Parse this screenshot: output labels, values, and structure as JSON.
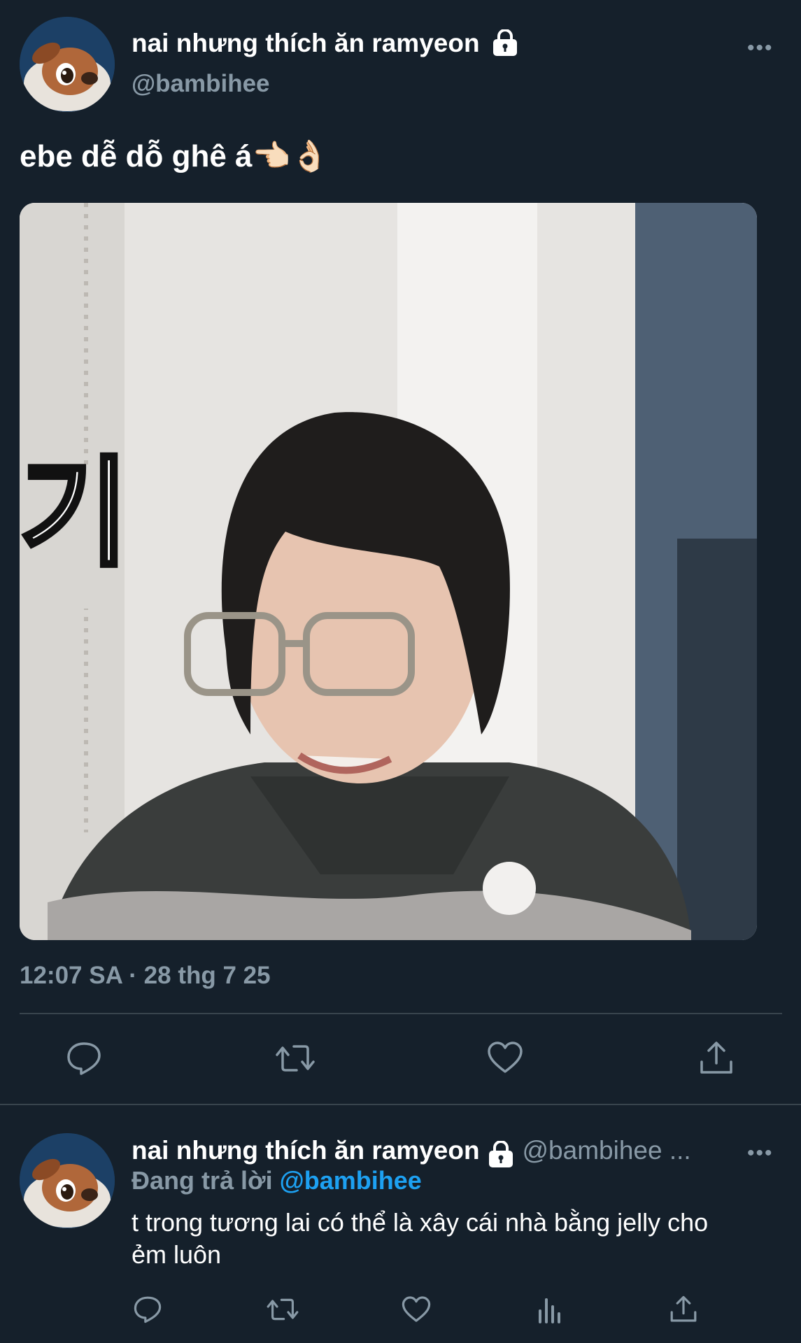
{
  "tweet": {
    "display_name": "nai nhưng thích ăn ramyeon",
    "handle": "@bambihee",
    "more_label": "•••",
    "text": "ebe dễ dỗ ghê á👈🏻👌🏻",
    "image_overlay_text": "기",
    "timestamp": "12:07 SA · 28 thg 7 25"
  },
  "reply": {
    "display_name": "nai nhưng thích ăn ramyeon",
    "handle": "@bambihee ...",
    "more_label": "•••",
    "replying_prefix": "Đang trả lời",
    "replying_to": "@bambihee",
    "text": "t trong tương lai có thể là xây cái nhà bằng jelly cho ẻm luôn"
  },
  "icons": {
    "lock": "lock-icon",
    "reply": "reply-icon",
    "retweet": "retweet-icon",
    "like": "heart-icon",
    "share": "share-icon",
    "analytics": "analytics-icon"
  },
  "colors": {
    "background": "#15202b",
    "secondary_text": "#8899a6",
    "link": "#1da1f2",
    "divider": "#38444d"
  }
}
